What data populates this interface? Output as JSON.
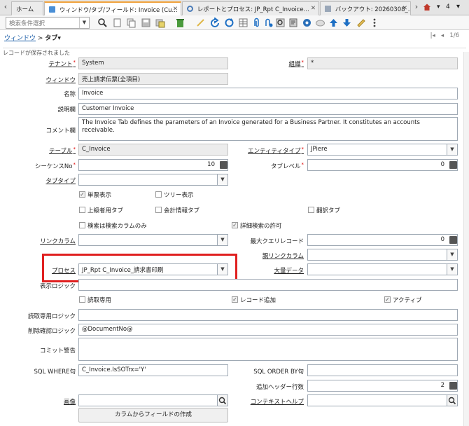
{
  "tabs": [
    {
      "label": "ホーム"
    },
    {
      "label": "ウィンドウ/タブ/フィールド: Invoice (Cu..."
    },
    {
      "label": "レポートとプロセス: JP_Rpt C_Invoice..."
    },
    {
      "label": "バックアウト: 20260308_..."
    }
  ],
  "tab_strip": {
    "count": "4",
    "more_arrow": "▾",
    "left_arrow": "‹",
    "right_arrow": "›",
    "close": "✕"
  },
  "toolbar": {
    "search_placeholder": "検索条件選択",
    "icons": [
      "search-icon",
      "new-record-icon",
      "copy-icon",
      "save-icon",
      "save-create-icon",
      "delete-icon",
      "export-icon",
      "undo-icon",
      "refresh-icon",
      "grid-toggle-icon",
      "attachment-icon",
      "chat-icon",
      "zoom-across-icon",
      "report-icon",
      "archive-icon",
      "process-icon",
      "settings-icon",
      "previous-record-icon",
      "next-record-icon",
      "help-icon",
      "more-icon"
    ]
  },
  "breadcrumb": {
    "window": "ウィンドウ",
    "sep": ">",
    "tab": "タブ",
    "caret": "▾"
  },
  "pager": {
    "first": "|◂",
    "prev": "◂",
    "text": "1/6"
  },
  "status": {
    "message": "レコードが保存されました"
  },
  "fields": {
    "tenant": {
      "label": "テナント",
      "value": "System"
    },
    "org": {
      "label": "組織",
      "value": "*"
    },
    "window": {
      "label": "ウィンドウ",
      "value": "売上請求伝票(全項目)"
    },
    "name": {
      "label": "名称",
      "value": "Invoice"
    },
    "description": {
      "label": "説明欄",
      "value": "Customer Invoice"
    },
    "comment": {
      "label": "コメント欄",
      "value": "The Invoice Tab defines the parameters of an Invoice generated for a Business Partner.  It constitutes an accounts receivable."
    },
    "table": {
      "label": "テーブル",
      "value": "C_Invoice"
    },
    "entity_type": {
      "label": "エンティティタイプ",
      "value": "JPiere"
    },
    "sequence": {
      "label": "シーケンスNo",
      "value": "10"
    },
    "tab_level": {
      "label": "タブレベル",
      "value": "0"
    },
    "tab_type": {
      "label": "タブタイプ",
      "value": ""
    },
    "link_column": {
      "label": "リンクカラム",
      "value": ""
    },
    "max_query": {
      "label": "最大クエリレコード",
      "value": "0"
    },
    "parent_link": {
      "label": "親リンクカラム",
      "value": ""
    },
    "process": {
      "label": "プロセス",
      "value": "JP_Rpt C_Invoice_請求書印刷"
    },
    "bulk_data": {
      "label": "大量データ",
      "value": ""
    },
    "display_logic": {
      "label": "表示ロジック",
      "value": ""
    },
    "readonly_logic": {
      "label": "読取専用ロジック",
      "value": ""
    },
    "delete_logic": {
      "label": "削除確認ロジック",
      "value": "@DocumentNo@"
    },
    "commit_warning": {
      "label": "コミット警告",
      "value": ""
    },
    "sql_where": {
      "label": "SQL WHERE句",
      "value": "C_Invoice.IsSOTrx='Y'"
    },
    "sql_order": {
      "label": "SQL ORDER BY句",
      "value": ""
    },
    "header_rows": {
      "label": "追加ヘッダー行数",
      "value": "2"
    },
    "image": {
      "label": "画像",
      "value": ""
    },
    "context_help": {
      "label": "コンテキストヘルプ",
      "value": ""
    }
  },
  "checkboxes": {
    "single_row": {
      "label": "単票表示",
      "checked": true
    },
    "tree": {
      "label": "ツリー表示",
      "checked": false
    },
    "advanced": {
      "label": "上級者用タブ",
      "checked": false
    },
    "accounting": {
      "label": "会計情報タブ",
      "checked": false
    },
    "translation": {
      "label": "翻訳タブ",
      "checked": false
    },
    "search_only": {
      "label": "検索は検索カラムのみ",
      "checked": false
    },
    "allow_detail": {
      "label": "詳細検索の許可",
      "checked": true
    },
    "read_only": {
      "label": "読取専用",
      "checked": false
    },
    "insert_record": {
      "label": "レコード追加",
      "checked": true
    },
    "active": {
      "label": "アクティブ",
      "checked": true
    }
  },
  "buttons": {
    "create_fields": "カラムからフィールドの作成"
  },
  "colors": {
    "accent": "#f0a23c",
    "link": "#1e5fa8",
    "highlight": "#e02020",
    "toolbar_blue": "#1d6fc4"
  }
}
